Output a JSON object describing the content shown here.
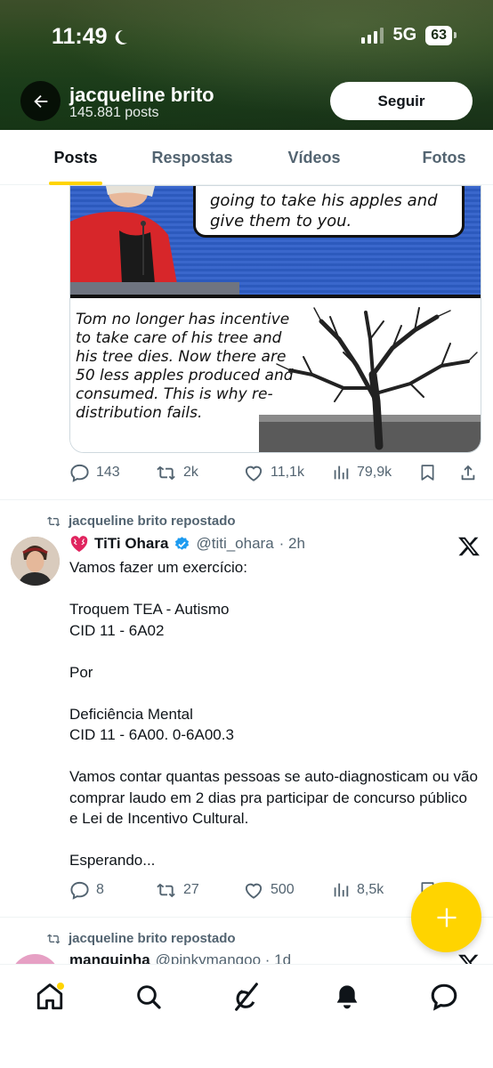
{
  "status_bar": {
    "time": "11:49",
    "network": "5G",
    "battery": "63"
  },
  "profile": {
    "name": "jacqueline brito",
    "post_count": "145.881 posts",
    "follow_label": "Seguir"
  },
  "tabs": [
    {
      "label": "Posts",
      "active": true
    },
    {
      "label": "Respostas",
      "active": false
    },
    {
      "label": "Vídeos",
      "active": false
    },
    {
      "label": "Fotos",
      "active": false
    }
  ],
  "post1": {
    "image_bubble_text": "going to take his apples and give them to you.",
    "image_caption_text": "Tom no longer has incentive to take care of his tree and his tree dies. Now there are 50 less apples produced and consumed. This is why re-distribution fails.",
    "replies": "143",
    "reposts": "2k",
    "likes": "11,1k",
    "views": "79,9k"
  },
  "post2": {
    "repost_label": "jacqueline brito repostado",
    "author_name": "TiTi Ohara",
    "handle": "@titi_ohara",
    "time": "· 2h",
    "text": "Vamos fazer um exercício:\n\nTroquem TEA - Autismo\nCID 11 - 6A02\n\nPor\n\nDeficiência Mental\nCID 11 - 6A00. 0-6A00.3\n\nVamos contar quantas pessoas se auto-diagnosticam ou vão comprar laudo em 2 dias pra participar de concurso público e Lei de Incentivo Cultural.\n\nEsperando...",
    "replies": "8",
    "reposts": "27",
    "likes": "500",
    "views": "8,5k"
  },
  "post3": {
    "repost_label": "jacqueline brito repostado",
    "author_name_partial": "manguinha",
    "handle_partial": "@pinkymangoo · 1d"
  },
  "colors": {
    "accent": "#ffd400",
    "muted": "#536471",
    "verified": "#1d9bf0"
  },
  "icons": {
    "back": "arrow-left-icon",
    "reply": "speech-bubble-icon",
    "repost": "repost-arrows-icon",
    "like": "heart-icon",
    "views": "bar-chart-icon",
    "bookmark": "bookmark-icon",
    "share": "share-icon",
    "x_logo": "x-logo-icon",
    "verified": "verified-badge-icon",
    "compose": "plus-icon",
    "nav": [
      "home-icon",
      "search-icon",
      "grok-icon",
      "notifications-icon",
      "messages-icon"
    ]
  }
}
